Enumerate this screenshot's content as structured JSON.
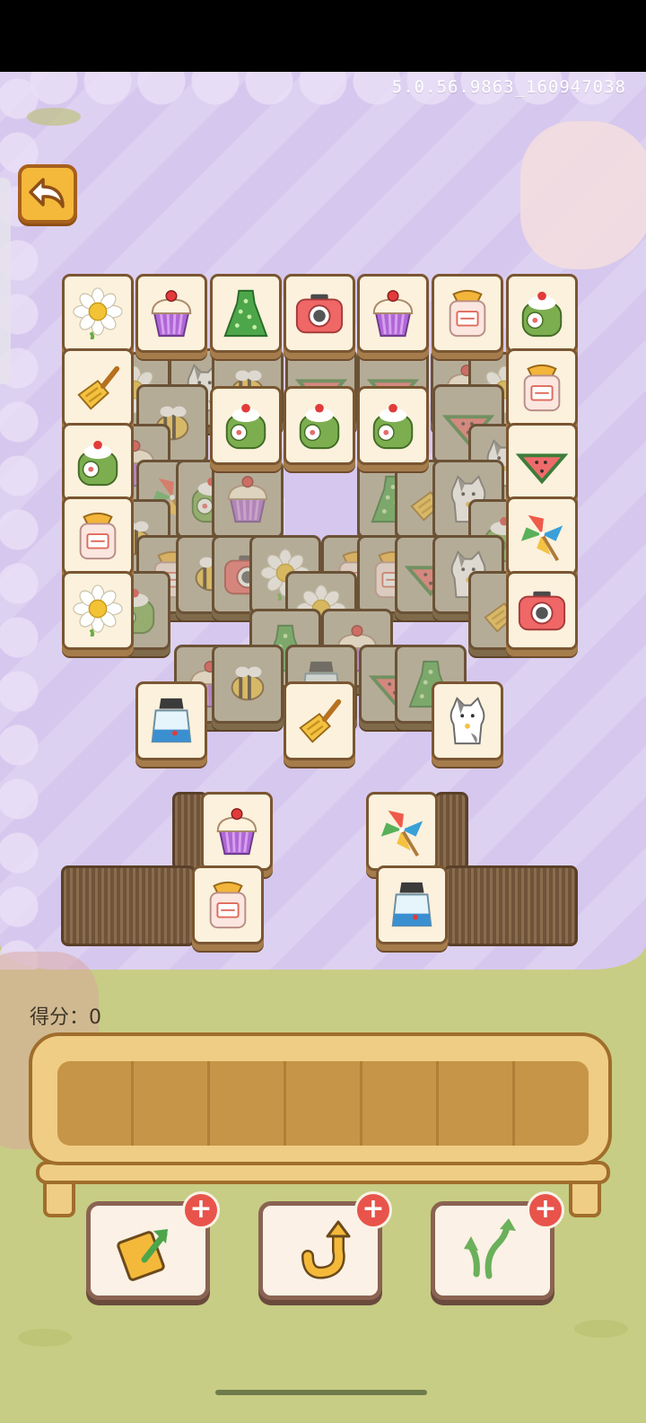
{
  "version": "5.0.56.9863_160947038",
  "score": {
    "label": "得分：",
    "value": "0"
  },
  "back_button": {
    "icon": "back-arrow-icon"
  },
  "tools": [
    {
      "name": "shuffle",
      "icon": "shuffle-card-icon",
      "badge": "+"
    },
    {
      "name": "undo",
      "icon": "undo-arrow-icon",
      "badge": "+"
    },
    {
      "name": "move-out",
      "icon": "move-out-arrows-icon",
      "badge": "+"
    }
  ],
  "tray_slots": 7,
  "colors": {
    "background": "#c7cd84",
    "board": "#d6c7ee",
    "tile": "#fbf1dc",
    "tray": "#efcd84",
    "badge": "#e8544b"
  },
  "tiles_top_layer": [
    "flower",
    "cupcake",
    "dress",
    "camera",
    "cupcake",
    "perfume",
    "cake-roll",
    "spatula",
    "perfume",
    "cake-roll",
    "cake-roll",
    "cake-roll",
    "cake-roll",
    "watermelon",
    "perfume",
    "pinwheel",
    "flower",
    "camera",
    "salt-shaker",
    "spatula",
    "cat",
    "cupcake",
    "pinwheel",
    "perfume",
    "salt-shaker"
  ]
}
